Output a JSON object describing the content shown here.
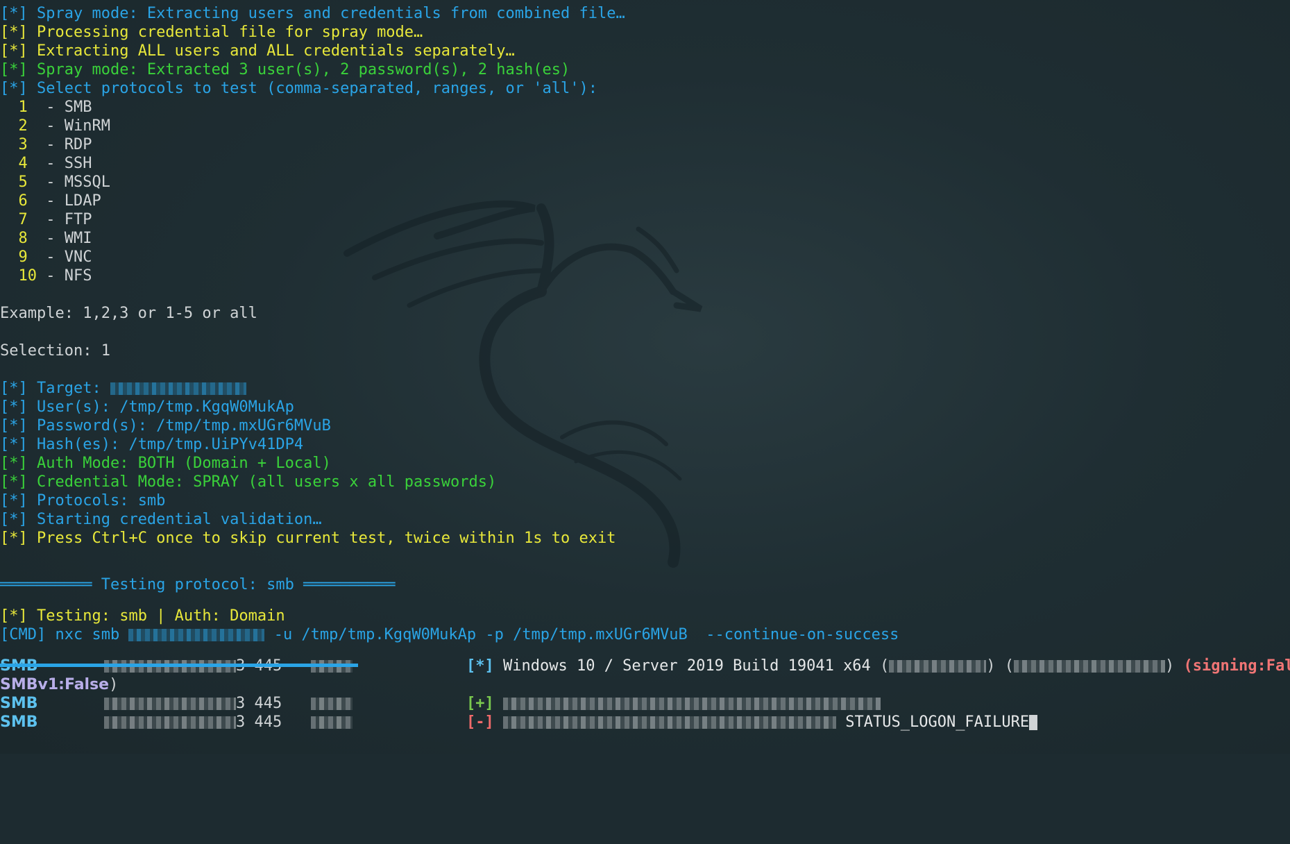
{
  "terminal": {
    "lines_top": [
      {
        "prefix": "[*]",
        "text": " Spray mode: Extracting users and credentials from combined file…",
        "color": "blue"
      },
      {
        "prefix": "[*]",
        "text": " Processing credential file for spray mode…",
        "color": "yellow"
      },
      {
        "prefix": "[*]",
        "text": " Extracting ALL users and ALL credentials separately…",
        "color": "yellow"
      },
      {
        "prefix": "[*]",
        "text": " Spray mode: Extracted 3 user(s), 2 password(s), 2 hash(es)",
        "color": "green"
      },
      {
        "prefix": "[*]",
        "text": " Select protocols to test (comma-separated, ranges, or 'all'):",
        "color": "blue"
      }
    ],
    "protocols": [
      {
        "num": "1",
        "name": "SMB"
      },
      {
        "num": "2",
        "name": "WinRM"
      },
      {
        "num": "3",
        "name": "RDP"
      },
      {
        "num": "4",
        "name": "SSH"
      },
      {
        "num": "5",
        "name": "MSSQL"
      },
      {
        "num": "6",
        "name": "LDAP"
      },
      {
        "num": "7",
        "name": "FTP"
      },
      {
        "num": "8",
        "name": "WMI"
      },
      {
        "num": "9",
        "name": "VNC"
      },
      {
        "num": "10",
        "name": "NFS"
      }
    ],
    "example": "Example: 1,2,3 or 1-5 or all",
    "selection": "Selection: 1",
    "info": {
      "target_label": " Target: ",
      "users": " User(s): /tmp/tmp.KgqW0MukAp",
      "passwords": " Password(s): /tmp/tmp.mxUGr6MVuB",
      "hashes": " Hash(es): /tmp/tmp.UiPYv41DP4",
      "auth_mode": " Auth Mode: BOTH (Domain + Local)",
      "cred_mode": " Credential Mode: SPRAY (all users x all passwords)",
      "protocols": " Protocols: smb",
      "starting": " Starting credential validation…",
      "press": " Press Ctrl+C once to skip current test, twice within 1s to exit"
    },
    "prefix_star": "[*]",
    "banner_left": "══════════",
    "banner_text": " Testing protocol: smb ",
    "banner_right": "══════════",
    "testing": " Testing: smb | Auth: Domain",
    "cmd_prefix": "[CMD]",
    "cmd_a": " nxc smb ",
    "cmd_b": " -u /tmp/tmp.KgqW0MukAp -p /tmp/tmp.mxUGr6MVuB  --continue-on-success",
    "smb_label": "SMB",
    "smb_port_frag": "3 445",
    "smb_row1_marker": "[*]",
    "smb_row1_text": " Windows 10 / Server 2019 Build 19041 x64 ",
    "smb_row1_paren_open": "(",
    "smb_row1_paren_close": ")",
    "signing": "(signing:False",
    "smbv1": "SMBv1:False",
    "smbv1_close": ")",
    "smb_row2_marker": "[+]",
    "smb_row3_marker": "[-]",
    "status": "STATUS_LOGON_FAILURE"
  }
}
